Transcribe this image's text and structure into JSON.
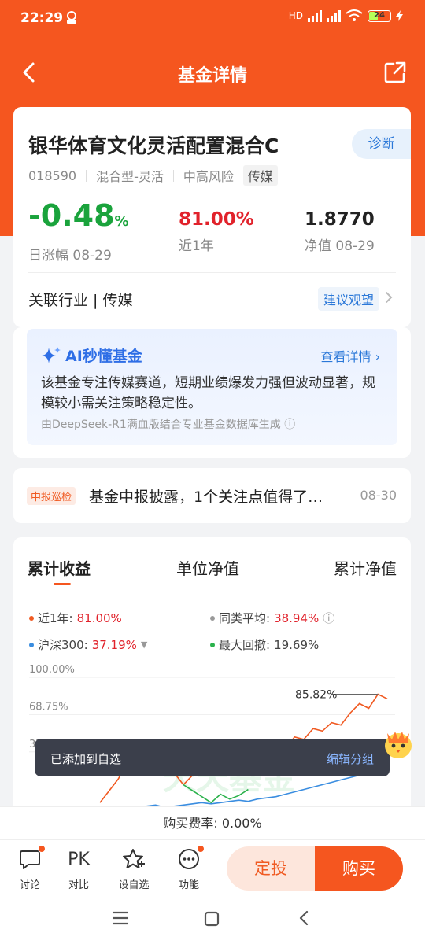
{
  "status_bar": {
    "time": "22:29",
    "battery": "24",
    "network": "HD"
  },
  "navbar": {
    "title": "基金详情"
  },
  "fund": {
    "name": "银华体育文化灵活配置混合C",
    "code": "018590",
    "category": "混合型-灵活",
    "risk": "中高风险",
    "theme_tag": "传媒",
    "diagnose": "诊断",
    "daily_change": "-0.48",
    "daily_change_unit": "%",
    "daily_change_label": "日涨幅 08-29",
    "year_return": "81.00%",
    "year_return_label": "近1年",
    "nav": "1.8770",
    "nav_label": "净值 08-29",
    "industry": "关联行业 | 传媒",
    "advice": "建议观望"
  },
  "ai": {
    "title": "AI秒懂基金",
    "more": "查看详情",
    "summary": "该基金专注传媒赛道，短期业绩爆发力强但波动显著，规模较小需关注策略稳定性。",
    "source": "由DeepSeek-R1满血版结合专业基金数据库生成"
  },
  "news": {
    "tag": "中报巡检",
    "text": "基金中报披露，1个关注点值得了…",
    "date": "08-30"
  },
  "chart_tabs": [
    "累计收益",
    "单位净值",
    "累计净值"
  ],
  "legend": {
    "fund_label": "近1年:",
    "fund_value": "81.00%",
    "peer_label": "同类平均:",
    "peer_value": "38.94%",
    "index_label": "沪深300:",
    "index_value": "37.19%",
    "drawdown_label": "最大回撤:",
    "drawdown_value": "19.69%"
  },
  "chart_data": {
    "type": "line",
    "y_tick_labels": [
      "100.00%",
      "68.75%",
      "37.50%"
    ],
    "peak_label": "85.82%",
    "watermark": "天天基金",
    "series": [
      {
        "name": "近1年",
        "color": "#f05a22",
        "values": [
          -5,
          5,
          15,
          30,
          22,
          28,
          25,
          35,
          20,
          10,
          18,
          22,
          27,
          24,
          30,
          32,
          29,
          38,
          36,
          42,
          40,
          50,
          48,
          57,
          55,
          62,
          60,
          70,
          78,
          74,
          85.82,
          82
        ]
      },
      {
        "name": "沪深300",
        "color": "#3a8de0",
        "values": [
          -10,
          -9,
          -8,
          -10,
          -9,
          -8,
          -7,
          -9,
          -8,
          -7,
          -6,
          -5,
          -6,
          -5,
          -4,
          -3,
          -4,
          -2,
          -1,
          0,
          2,
          4,
          6,
          8,
          10,
          12,
          14,
          16,
          18,
          20,
          22,
          24
        ]
      },
      {
        "name": "最大回撤",
        "color": "#2bb24c",
        "values": [
          null,
          null,
          null,
          null,
          null,
          null,
          null,
          null,
          null,
          10,
          5,
          0,
          -5,
          2,
          -2,
          1,
          6,
          null,
          null,
          null,
          null,
          null,
          null,
          null,
          null,
          null,
          null,
          null,
          null,
          null,
          null,
          null
        ]
      }
    ],
    "ylim": [
      -20,
      100
    ]
  },
  "toast": {
    "message": "已添加到自选",
    "action": "编辑分组"
  },
  "fee": "购买费率: 0.00%",
  "actions": [
    {
      "label": "讨论",
      "icon": "chat-icon"
    },
    {
      "label": "对比",
      "icon": "pk-icon",
      "glyph": "PK"
    },
    {
      "label": "设自选",
      "icon": "star-icon"
    },
    {
      "label": "功能",
      "icon": "more-icon"
    }
  ],
  "buttons": {
    "regular_invest": "定投",
    "buy": "购买"
  },
  "colors": {
    "brand": "#f5561f",
    "up": "#e1222b",
    "down": "#1aa33c",
    "link": "#2b78d8"
  }
}
